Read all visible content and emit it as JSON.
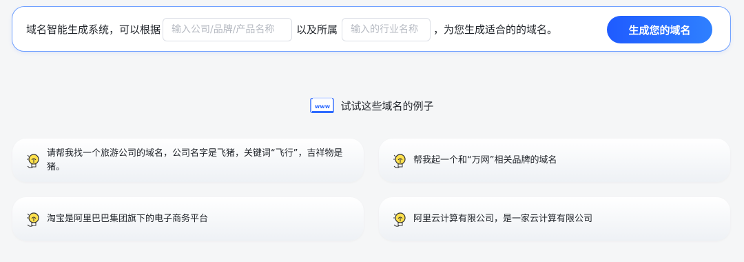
{
  "top_bar": {
    "prefix_text": "域名智能生成系统，可以根据",
    "company_input": {
      "placeholder": "输入公司/品牌/产品名称",
      "value": ""
    },
    "middle_text": "以及所属",
    "industry_input": {
      "placeholder": "输入的行业名称",
      "value": ""
    },
    "suffix_text": "，为您生成适合的的域名。",
    "generate_button_label": "生成您的域名"
  },
  "examples": {
    "icon_label": "www",
    "title": "试试这些域名的例子",
    "items": [
      {
        "text": "请帮我找一个旅游公司的域名，公司名字是飞猪，关键词“飞行”，吉祥物是猪。",
        "icon": "lightbulb-icon"
      },
      {
        "text": "帮我起一个和“万网”相关品牌的域名",
        "icon": "lightbulb-icon"
      },
      {
        "text": "淘宝是阿里巴巴集团旗下的电子商务平台",
        "icon": "lightbulb-icon"
      },
      {
        "text": "阿里云计算有限公司，是一家云计算有限公司",
        "icon": "lightbulb-icon"
      }
    ]
  },
  "colors": {
    "accent": "#1f5bff",
    "border": "#6fa0ff",
    "page_bg": "#f5f6f7"
  }
}
